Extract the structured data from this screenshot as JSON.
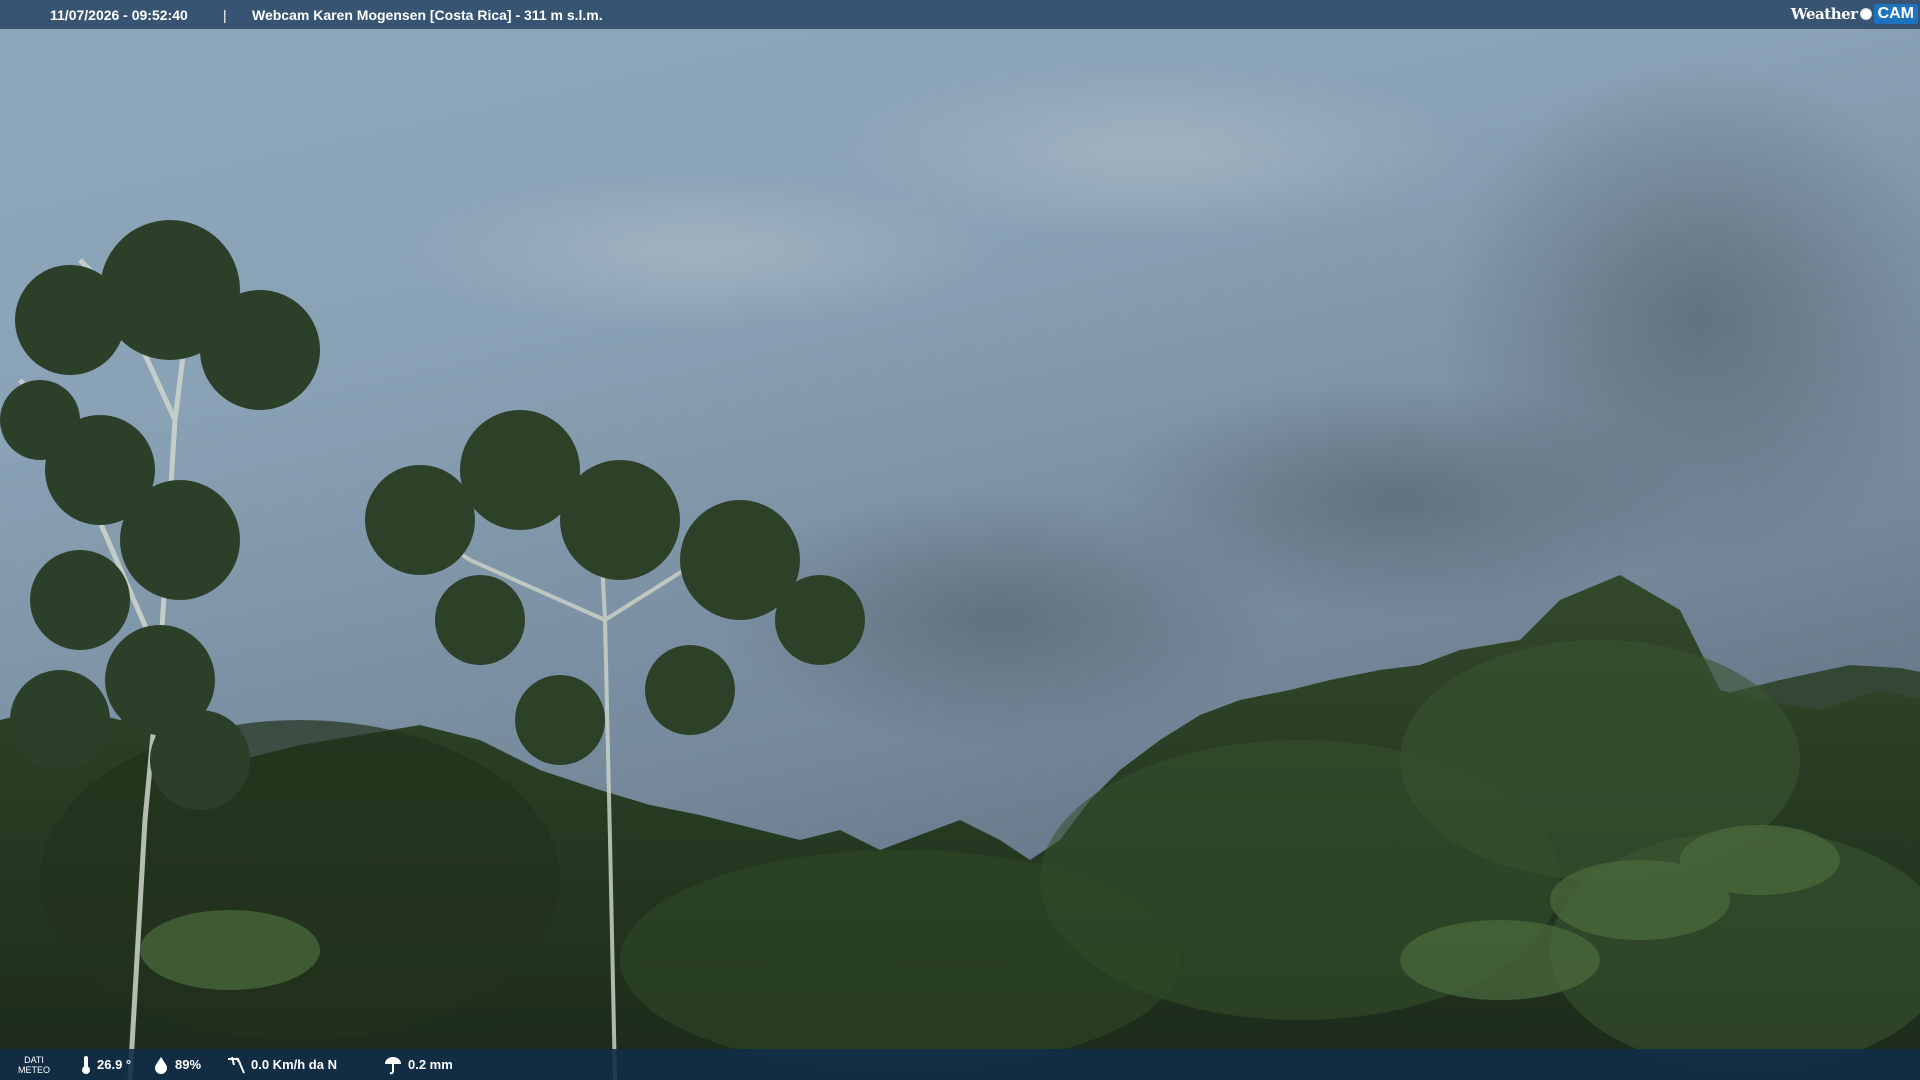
{
  "header": {
    "datetime": "11/07/2026 - 09:52:40",
    "separator": "|",
    "title": "Webcam Karen Mogensen [Costa Rica]  - 311 m s.l.m."
  },
  "logo": {
    "weather_text": "Weather",
    "cam_text": "CAM"
  },
  "footer": {
    "dati_line1": "DATI",
    "dati_line2": "METEO",
    "temperature": "26.9 °",
    "humidity": "89%",
    "wind": "0.0 Km/h da N",
    "rain": "0.2 mm",
    "icons": [
      "thermometer-icon",
      "humidity-icon",
      "wind-icon",
      "rain-icon"
    ]
  },
  "colors": {
    "topbar": "#304e6c",
    "bottombar": "#122d48",
    "sky": "#8aa0b2",
    "foliage": "#2b3d22"
  }
}
